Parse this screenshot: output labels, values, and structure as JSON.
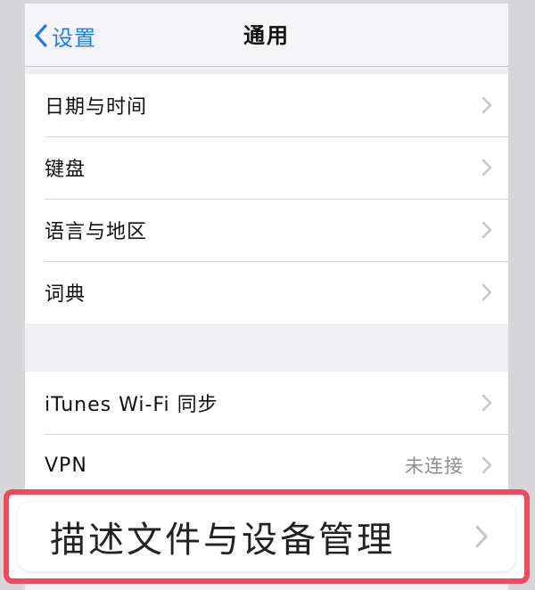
{
  "navbar": {
    "back_label": "设置",
    "title": "通用"
  },
  "group1": {
    "items": [
      {
        "label": "日期与时间"
      },
      {
        "label": "键盘"
      },
      {
        "label": "语言与地区"
      },
      {
        "label": "词典"
      }
    ]
  },
  "group2": {
    "items": [
      {
        "label": "iTunes Wi-Fi 同步"
      },
      {
        "label": "VPN",
        "value": "未连接"
      }
    ]
  },
  "highlight": {
    "label": "描述文件与设备管理",
    "border_color": "#f04a5c"
  },
  "colors": {
    "accent": "#1a7cf6",
    "chevron": "#c4c4c9",
    "secondary_text": "#8e8e93"
  },
  "icons": [
    "chevron-left-icon",
    "chevron-right-icon"
  ]
}
